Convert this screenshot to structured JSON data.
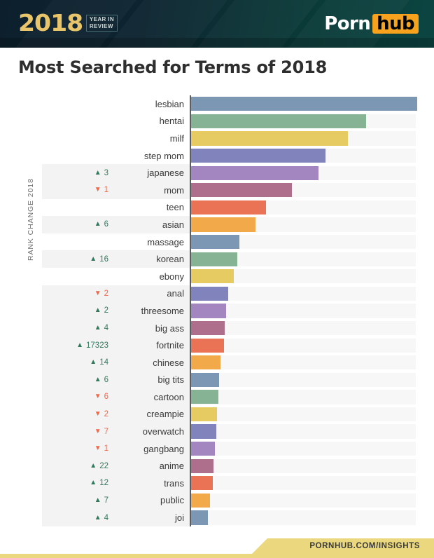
{
  "header": {
    "year": "2018",
    "year_in_review_line1": "YEAR IN",
    "year_in_review_line2": "REVIEW",
    "brand_part1": "Porn",
    "brand_part2": "hub",
    "brand_accent": "#f6a21d",
    "bg_dark": "#0d1f2d",
    "bg_teal": "#0b4541"
  },
  "title": "Most Searched for Terms of 2018",
  "axis": {
    "y_axis_title": "RANK CHANGE 2018"
  },
  "footer": {
    "url": "PORNHUB.COM/INSIGHTS",
    "band_color": "#ead77e",
    "text_color": "#3a3a3a"
  },
  "palette": [
    "#7b97b3",
    "#86b394",
    "#e6cb62",
    "#8183bd",
    "#a386bf",
    "#ad6f8c",
    "#eb7355",
    "#f2a94a"
  ],
  "chart_data": {
    "type": "bar",
    "title": "Most Searched for Terms of 2018",
    "xlabel": "",
    "ylabel": "RANK CHANGE 2018",
    "orientation": "horizontal",
    "grid": false,
    "legend": false,
    "xlim": [
      0,
      100
    ],
    "categories": [
      "lesbian",
      "hentai",
      "milf",
      "step mom",
      "japanese",
      "mom",
      "teen",
      "asian",
      "massage",
      "korean",
      "ebony",
      "anal",
      "threesome",
      "big ass",
      "fortnite",
      "chinese",
      "big tits",
      "cartoon",
      "creampie",
      "overwatch",
      "gangbang",
      "anime",
      "trans",
      "public",
      "joi"
    ],
    "values": [
      100.0,
      77.5,
      69.5,
      59.5,
      56.5,
      44.5,
      33.0,
      28.5,
      21.5,
      20.5,
      19.0,
      16.5,
      15.5,
      15.0,
      14.5,
      13.0,
      12.5,
      12.0,
      11.5,
      11.0,
      10.5,
      10.0,
      9.5,
      8.5,
      7.5
    ],
    "rank_changes": [
      null,
      null,
      null,
      null,
      3,
      -1,
      null,
      6,
      null,
      16,
      null,
      -2,
      2,
      4,
      17323,
      14,
      6,
      -6,
      -2,
      -7,
      -1,
      22,
      12,
      7,
      4
    ]
  },
  "rows": [
    {
      "term": "lesbian",
      "change": "",
      "dir": "none",
      "value": 100.0
    },
    {
      "term": "hentai",
      "change": "",
      "dir": "none",
      "value": 77.5
    },
    {
      "term": "milf",
      "change": "",
      "dir": "none",
      "value": 69.5
    },
    {
      "term": "step mom",
      "change": "",
      "dir": "none",
      "value": 59.5
    },
    {
      "term": "japanese",
      "change": "3",
      "dir": "up",
      "value": 56.5
    },
    {
      "term": "mom",
      "change": "1",
      "dir": "down",
      "value": 44.5
    },
    {
      "term": "teen",
      "change": "",
      "dir": "none",
      "value": 33.0
    },
    {
      "term": "asian",
      "change": "6",
      "dir": "up",
      "value": 28.5
    },
    {
      "term": "massage",
      "change": "",
      "dir": "none",
      "value": 21.5
    },
    {
      "term": "korean",
      "change": "16",
      "dir": "up",
      "value": 20.5
    },
    {
      "term": "ebony",
      "change": "",
      "dir": "none",
      "value": 19.0
    },
    {
      "term": "anal",
      "change": "2",
      "dir": "down",
      "value": 16.5
    },
    {
      "term": "threesome",
      "change": "2",
      "dir": "up",
      "value": 15.5
    },
    {
      "term": "big ass",
      "change": "4",
      "dir": "up",
      "value": 15.0
    },
    {
      "term": "fortnite",
      "change": "17323",
      "dir": "up",
      "value": 14.5
    },
    {
      "term": "chinese",
      "change": "14",
      "dir": "up",
      "value": 13.0
    },
    {
      "term": "big tits",
      "change": "6",
      "dir": "up",
      "value": 12.5
    },
    {
      "term": "cartoon",
      "change": "6",
      "dir": "down",
      "value": 12.0
    },
    {
      "term": "creampie",
      "change": "2",
      "dir": "down",
      "value": 11.5
    },
    {
      "term": "overwatch",
      "change": "7",
      "dir": "down",
      "value": 11.0
    },
    {
      "term": "gangbang",
      "change": "1",
      "dir": "down",
      "value": 10.5
    },
    {
      "term": "anime",
      "change": "22",
      "dir": "up",
      "value": 10.0
    },
    {
      "term": "trans",
      "change": "12",
      "dir": "up",
      "value": 9.5
    },
    {
      "term": "public",
      "change": "7",
      "dir": "up",
      "value": 8.5
    },
    {
      "term": "joi",
      "change": "4",
      "dir": "up",
      "value": 7.5
    }
  ]
}
